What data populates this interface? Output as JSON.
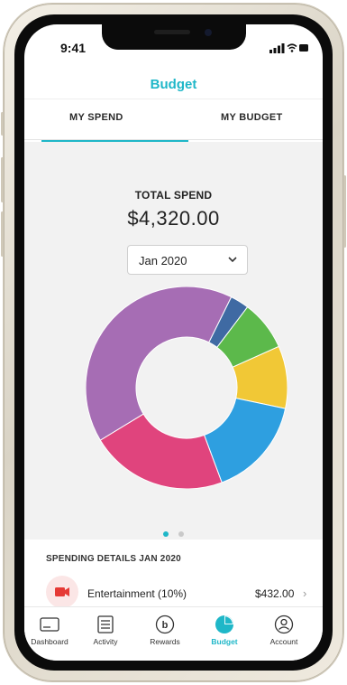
{
  "status_bar": {
    "time": "9:41"
  },
  "header": {
    "title": "Budget"
  },
  "tabs": [
    {
      "label": "MY SPEND",
      "active": true
    },
    {
      "label": "MY BUDGET",
      "active": false
    }
  ],
  "summary": {
    "label": "TOTAL SPEND",
    "value": "$4,320.00",
    "period_select": "Jan 2020"
  },
  "chart_data": {
    "type": "pie",
    "style": "donut",
    "title": "",
    "slices": [
      {
        "color": "#f1c836",
        "value": 10
      },
      {
        "color": "#2e9fe0",
        "value": 16
      },
      {
        "color": "#e0447d",
        "value": 22
      },
      {
        "color": "#a66db4",
        "value": 41
      },
      {
        "color": "#3f6aa3",
        "value": 3
      },
      {
        "color": "#5cb94b",
        "value": 8
      }
    ]
  },
  "pager": {
    "pages": 2,
    "current": 1
  },
  "details": {
    "title": "SPENDING DETAILS JAN 2020",
    "rows": [
      {
        "label": "Entertainment (10%)",
        "amount": "$432.00",
        "icon": "video-camera-icon",
        "icon_color": "#e53935"
      }
    ]
  },
  "nav": [
    {
      "label": "Dashboard",
      "icon": "card-icon",
      "active": false
    },
    {
      "label": "Activity",
      "icon": "receipt-icon",
      "active": false
    },
    {
      "label": "Rewards",
      "icon": "rewards-b-icon",
      "active": false
    },
    {
      "label": "Budget",
      "icon": "pie-chart-icon",
      "active": true
    },
    {
      "label": "Account",
      "icon": "person-icon",
      "active": false
    }
  ],
  "colors": {
    "accent": "#1fb7c8"
  }
}
